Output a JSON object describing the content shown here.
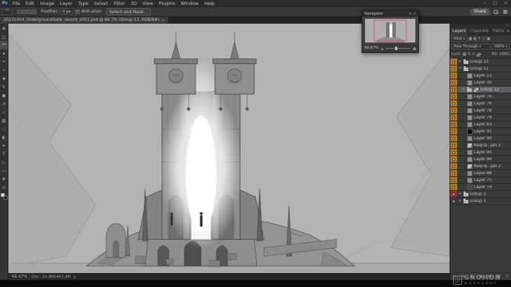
{
  "app": {
    "logo_text": "Ps"
  },
  "menubar": {
    "items": [
      "File",
      "Edit",
      "Image",
      "Layer",
      "Type",
      "Select",
      "Filter",
      "3D",
      "View",
      "Plugins",
      "Window",
      "Help"
    ],
    "window_controls": [
      {
        "name": "minimize",
        "glyph": "–"
      },
      {
        "name": "maximize",
        "glyph": "□"
      },
      {
        "name": "close",
        "glyph": "×"
      }
    ]
  },
  "options_bar": {
    "tool_icon_glyph": "⌒",
    "feather_label": "Feather:",
    "feather_value": "0 px",
    "antialias_check_glyph": "✓",
    "antialias_label": "Anti-alias",
    "select_and_mask_label": "Select and Mask...",
    "share_label": "Share",
    "workspace_icon_glyph": "▦"
  },
  "document_tabs": [
    {
      "title": "20231004_UndergroundGate_record_v001.psd @ 66.7% (Group 13, RGB/8#)",
      "close_glyph": "×",
      "active": true
    }
  ],
  "toolbar": {
    "tools": [
      {
        "name": "move",
        "glyph": "✥"
      },
      {
        "name": "rectangular-marquee",
        "glyph": "□"
      },
      {
        "name": "lasso",
        "glyph": "⌒",
        "active": true
      },
      {
        "name": "quick-selection",
        "glyph": "✦"
      },
      {
        "name": "crop",
        "glyph": "⌗"
      },
      {
        "name": "eyedropper",
        "glyph": "✧"
      },
      {
        "name": "spot-healing",
        "glyph": "✚"
      },
      {
        "name": "brush",
        "glyph": "✎"
      },
      {
        "name": "clone-stamp",
        "glyph": "▣"
      },
      {
        "name": "history-brush",
        "glyph": "↺"
      },
      {
        "name": "eraser",
        "glyph": "▱"
      },
      {
        "name": "gradient",
        "glyph": "▨"
      },
      {
        "name": "blur",
        "glyph": "◌"
      },
      {
        "name": "dodge",
        "glyph": "◐"
      },
      {
        "name": "pen",
        "glyph": "✒"
      },
      {
        "name": "type",
        "glyph": "T"
      },
      {
        "name": "path-selection",
        "glyph": "▷"
      },
      {
        "name": "shape",
        "glyph": "▭"
      },
      {
        "name": "hand",
        "glyph": "❖"
      },
      {
        "name": "zoom",
        "glyph": "⊙"
      }
    ]
  },
  "navigator": {
    "title": "Navigator",
    "menu_icon_glyph": "≡",
    "close_icon_glyph": "×",
    "zoom": "66.67%",
    "zoom_out_glyph": "▲",
    "zoom_in_glyph": "▲"
  },
  "layers_panel": {
    "collapse_glyph": "«",
    "tabs": [
      {
        "name": "Layers",
        "active": true
      },
      {
        "name": "Channels",
        "active": false
      },
      {
        "name": "Paths",
        "active": false
      }
    ],
    "tab_menu_glyph": "≡",
    "filter_label": "Kind",
    "filter_icons": [
      {
        "name": "pixel-filter",
        "glyph": "▦"
      },
      {
        "name": "adjustment-filter",
        "glyph": "◐"
      },
      {
        "name": "type-filter",
        "glyph": "T"
      },
      {
        "name": "shape-filter",
        "glyph": "◻"
      },
      {
        "name": "smart-object-filter",
        "glyph": "▣"
      }
    ],
    "blend_mode": "Pass Through",
    "opacity_value": "100%",
    "lock_label": "Lock:",
    "lock_icons": [
      {
        "name": "lock-transparency",
        "glyph": "▩"
      },
      {
        "name": "lock-pixels",
        "glyph": "✎"
      },
      {
        "name": "lock-position",
        "glyph": "✛"
      }
    ],
    "fill_label": "Fill:",
    "fill_value": "100%",
    "items": [
      {
        "name": "Group 13",
        "kind": "group",
        "tag": "yellow",
        "indent": 0,
        "thumb": "none",
        "expander": "▸"
      },
      {
        "name": "Group 11",
        "kind": "group",
        "tag": "yellow",
        "indent": 0,
        "thumb": "none",
        "expander": "▾"
      },
      {
        "name": "Layer 12",
        "kind": "layer",
        "tag": "yellow",
        "indent": 1,
        "thumb": "gray"
      },
      {
        "name": "Layer 30",
        "kind": "layer",
        "tag": "yellow",
        "indent": 1,
        "thumb": "gray"
      },
      {
        "name": "Group 12",
        "kind": "group",
        "tag": "yellow",
        "indent": 1,
        "thumb": "checker",
        "selected": true,
        "expander": "▸"
      },
      {
        "name": "Layer 70",
        "kind": "layer",
        "tag": "yellow",
        "indent": 1,
        "thumb": "gray"
      },
      {
        "name": "Layer 76",
        "kind": "layer",
        "tag": "yellow",
        "indent": 1,
        "thumb": "gray"
      },
      {
        "name": "Layer 78",
        "kind": "layer",
        "tag": "yellow",
        "indent": 1,
        "thumb": "gray"
      },
      {
        "name": "Layer 79",
        "kind": "layer",
        "tag": "yellow",
        "indent": 1,
        "thumb": "gray"
      },
      {
        "name": "Layer 83",
        "kind": "layer",
        "tag": "yellow",
        "indent": 1,
        "thumb": "gray"
      },
      {
        "name": "Layer 91",
        "kind": "layer",
        "tag": "yellow",
        "indent": 1,
        "thumb": "black"
      },
      {
        "name": "Layer 90",
        "kind": "layer",
        "tag": "yellow",
        "indent": 1,
        "thumb": "gray"
      },
      {
        "name": "KeqiTa...Jan 1",
        "kind": "layer",
        "tag": "yellow",
        "indent": 1,
        "thumb": "photo"
      },
      {
        "name": "Layer 80",
        "kind": "layer",
        "tag": "yellow",
        "indent": 1,
        "thumb": "gray"
      },
      {
        "name": "Layer 86",
        "kind": "layer",
        "tag": "yellow",
        "indent": 1,
        "thumb": "gray"
      },
      {
        "name": "KeqiTa...Jan 2",
        "kind": "layer",
        "tag": "yellow",
        "indent": 1,
        "thumb": "photo"
      },
      {
        "name": "Layer 88",
        "kind": "layer",
        "tag": "yellow",
        "indent": 1,
        "thumb": "gray"
      },
      {
        "name": "Layer 75",
        "kind": "layer",
        "tag": "yellow",
        "indent": 1,
        "thumb": "gray"
      },
      {
        "name": "Layer 74",
        "kind": "layer",
        "tag": "yellow",
        "indent": 1,
        "thumb": "dark"
      },
      {
        "name": "Group 2",
        "kind": "group",
        "tag": "red",
        "indent": 0,
        "thumb": "none",
        "expander": "▸"
      },
      {
        "name": "Group 1",
        "kind": "group",
        "tag": "none",
        "indent": 0,
        "thumb": "none",
        "expander": "▸"
      }
    ],
    "bottom_icons": [
      {
        "name": "link-layers",
        "glyph": "∞"
      },
      {
        "name": "layer-effects",
        "glyph": "fx"
      },
      {
        "name": "add-layer-mask",
        "glyph": "◧"
      },
      {
        "name": "new-adjustment-layer",
        "glyph": "◑"
      },
      {
        "name": "new-group",
        "glyph": "▤"
      },
      {
        "name": "new-layer",
        "glyph": "▦"
      },
      {
        "name": "delete-layer",
        "glyph": "▽"
      }
    ]
  },
  "status_bar": {
    "zoom": "66.67%",
    "doc_info": "Doc: 34.9M/463.4M",
    "chevron_glyph": "❯"
  },
  "watermark": {
    "logo_glyph": "◱",
    "line1": "GNOMON",
    "line2": "WORKSHOP"
  },
  "colors": {
    "tag_yellow": "#a9781f",
    "tag_red": "#8f3430",
    "selection_highlight": "#5a5e63",
    "canvas_gray": "#b3b3b3"
  }
}
